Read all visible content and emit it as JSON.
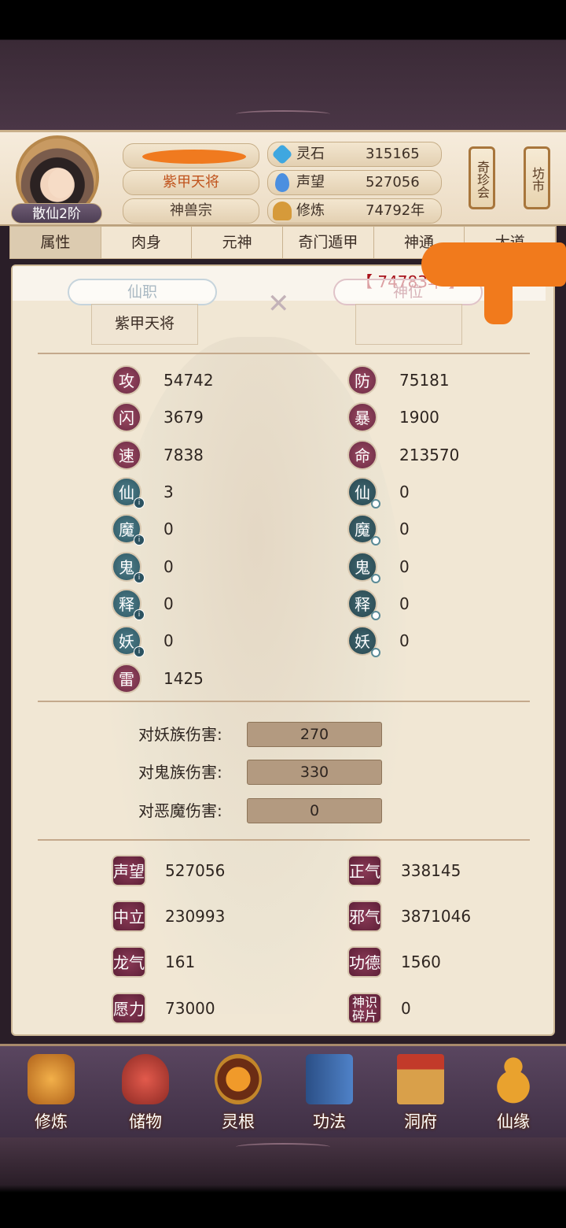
{
  "header": {
    "rank": "散仙2阶",
    "title": "紫甲天将",
    "sect": "神兽宗",
    "resources": [
      {
        "label": "灵石",
        "value": "315165",
        "icon": "spirit-stone-icon",
        "color": "#3fa7e0"
      },
      {
        "label": "声望",
        "value": "527056",
        "icon": "reputation-icon",
        "color": "#4b8fe0"
      },
      {
        "label": "修炼",
        "value": "74792年",
        "icon": "cultivation-icon",
        "color": "#d69a3a"
      }
    ],
    "side_buttons": [
      "奇珍会",
      "坊市"
    ]
  },
  "tabs": [
    "属性",
    "肉身",
    "元神",
    "奇门遁甲",
    "神通",
    "大道"
  ],
  "panel": {
    "year_text": "【 74783年 】",
    "job_left_label": "仙职",
    "job_left_value": "紫甲天将",
    "job_right_label": "神位",
    "stats_left": [
      {
        "badge": "攻",
        "value": "54742"
      },
      {
        "badge": "闪",
        "value": "3679"
      },
      {
        "badge": "速",
        "value": "7838"
      },
      {
        "badge": "仙",
        "value": "3"
      },
      {
        "badge": "魔",
        "value": "0"
      },
      {
        "badge": "鬼",
        "value": "0"
      },
      {
        "badge": "释",
        "value": "0"
      },
      {
        "badge": "妖",
        "value": "0"
      },
      {
        "badge": "雷",
        "value": "1425"
      }
    ],
    "stats_right": [
      {
        "badge": "防",
        "value": "75181"
      },
      {
        "badge": "暴",
        "value": "1900"
      },
      {
        "badge": "命",
        "value": "213570"
      },
      {
        "badge": "仙",
        "value": "0"
      },
      {
        "badge": "魔",
        "value": "0"
      },
      {
        "badge": "鬼",
        "value": "0"
      },
      {
        "badge": "释",
        "value": "0"
      },
      {
        "badge": "妖",
        "value": "0"
      }
    ],
    "damage": [
      {
        "label": "对妖族伤害:",
        "value": "270"
      },
      {
        "label": "对鬼族伤害:",
        "value": "330"
      },
      {
        "label": "对恶魔伤害:",
        "value": "0"
      }
    ],
    "reputation_left": [
      {
        "badge": "声望",
        "value": "527056"
      },
      {
        "badge": "中立",
        "value": "230993"
      },
      {
        "badge": "龙气",
        "value": "161"
      },
      {
        "badge": "愿力",
        "value": "73000"
      }
    ],
    "reputation_right": [
      {
        "badge": "正气",
        "value": "338145"
      },
      {
        "badge": "邪气",
        "value": "3871046"
      },
      {
        "badge": "功德",
        "value": "1560"
      },
      {
        "badge": "神识碎片",
        "value": "0"
      }
    ]
  },
  "bottom_nav": [
    {
      "label": "修炼",
      "icon": "cultivate-icon",
      "color": "#d9862a"
    },
    {
      "label": "储物",
      "icon": "storage-bag-icon",
      "color": "#c2443a"
    },
    {
      "label": "灵根",
      "icon": "spirit-root-icon",
      "color": "#b9581e"
    },
    {
      "label": "功法",
      "icon": "skill-book-icon",
      "color": "#3f6fb0"
    },
    {
      "label": "洞府",
      "icon": "cave-abode-icon",
      "color": "#c27a2a"
    },
    {
      "label": "仙缘",
      "icon": "gourd-icon",
      "color": "#d08a2a"
    }
  ]
}
